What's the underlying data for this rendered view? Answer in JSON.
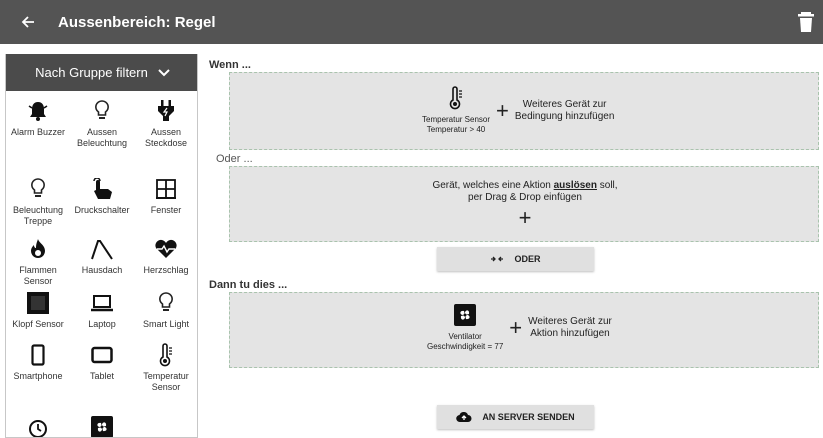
{
  "header": {
    "title": "Aussenbereich: Regel"
  },
  "sidebar": {
    "filter_label": "Nach Gruppe filtern",
    "devices": [
      {
        "label": "Alarm Buzzer",
        "icon": "bell-icon"
      },
      {
        "label": "Aussen Beleuchtung",
        "icon": "lightbulb-icon"
      },
      {
        "label": "Aussen Steckdose",
        "icon": "power-plug-icon"
      },
      {
        "label": "Beleuchtung Treppe",
        "icon": "lightbulb-icon"
      },
      {
        "label": "Druckschalter",
        "icon": "hand-pointer-icon"
      },
      {
        "label": "Fenster",
        "icon": "window-icon"
      },
      {
        "label": "Flammen Sensor",
        "icon": "fire-icon"
      },
      {
        "label": "Hausdach",
        "icon": "roof-icon"
      },
      {
        "label": "Herzschlag",
        "icon": "heart-pulse-icon"
      },
      {
        "label": "Klopf Sensor",
        "icon": "knock-sensor-icon"
      },
      {
        "label": "Laptop",
        "icon": "laptop-icon"
      },
      {
        "label": "Smart Light",
        "icon": "lightbulb-icon"
      },
      {
        "label": "Smartphone",
        "icon": "smartphone-icon"
      },
      {
        "label": "Tablet",
        "icon": "tablet-icon"
      },
      {
        "label": "Temperatur Sensor",
        "icon": "thermometer-icon"
      },
      {
        "label": "",
        "icon": "clock-icon"
      },
      {
        "label": "",
        "icon": "fan-icon"
      }
    ]
  },
  "main": {
    "if_label": "Wenn ...",
    "or_label": "Oder ...",
    "then_label": "Dann tu dies ...",
    "condition": {
      "device_name": "Temperatur Sensor",
      "device_value": "Temperatur > 40",
      "add_line1": "Weiteres Gerät zur",
      "add_line2": "Bedingung hinzufügen"
    },
    "trigger_zone": {
      "line1_pre": "Gerät, welches eine Aktion",
      "line1_bold": "auslösen",
      "line1_post": "soll,",
      "line2": "per Drag & Drop einfügen"
    },
    "or_button": "ODER",
    "action": {
      "device_name": "Ventilator",
      "device_value": "Geschwindigkeit = 77",
      "add_line1": "Weiteres Gerät zur",
      "add_line2": "Aktion hinzufügen"
    },
    "send_button": "AN SERVER SENDEN",
    "plus": "+"
  }
}
